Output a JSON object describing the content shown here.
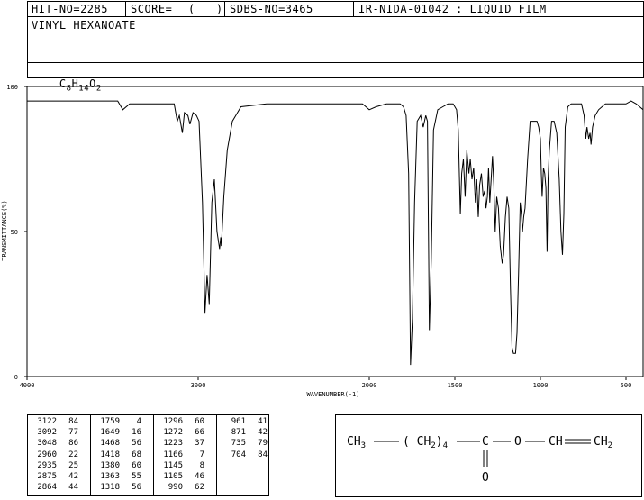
{
  "header": {
    "hit_no": "HIT-NO=2285",
    "score_label": "SCORE=",
    "score_value": "(   )",
    "sdbs_no": "SDBS-NO=3465",
    "ir_info": "IR-NIDA-01042 : LIQUID FILM"
  },
  "compound": {
    "name": "VINYL HEXANOATE",
    "formula_parts": [
      {
        "text": "C",
        "sub": false
      },
      {
        "text": "8",
        "sub": true
      },
      {
        "text": "H",
        "sub": false
      },
      {
        "text": "14",
        "sub": true
      },
      {
        "text": "O",
        "sub": false
      },
      {
        "text": "2",
        "sub": true
      }
    ]
  },
  "structure": {
    "ch3": "CH3",
    "ch2_group": "(CH2)4",
    "c": "C",
    "o_link": "O",
    "ch": "CH",
    "ch2_end": "CH2",
    "carbonyl_o": "O"
  },
  "peak_table": [
    [
      [
        "3122",
        "84"
      ],
      [
        "3092",
        "77"
      ],
      [
        "3048",
        "86"
      ],
      [
        "2960",
        "22"
      ],
      [
        "2935",
        "25"
      ],
      [
        "2875",
        "42"
      ],
      [
        "2864",
        "44"
      ]
    ],
    [
      [
        "1759",
        "4"
      ],
      [
        "1649",
        "16"
      ],
      [
        "1468",
        "56"
      ],
      [
        "1418",
        "68"
      ],
      [
        "1380",
        "60"
      ],
      [
        "1363",
        "55"
      ],
      [
        "1318",
        "56"
      ]
    ],
    [
      [
        "1296",
        "60"
      ],
      [
        "1272",
        "66"
      ],
      [
        "1223",
        "37"
      ],
      [
        "1166",
        "7"
      ],
      [
        "1145",
        "8"
      ],
      [
        "1105",
        "46"
      ],
      [
        "990",
        "62"
      ]
    ],
    [
      [
        "961",
        "41"
      ],
      [
        "871",
        "42"
      ],
      [
        "735",
        "79"
      ],
      [
        "704",
        "84"
      ]
    ]
  ],
  "chart_data": {
    "type": "line",
    "xlabel": "WAVENUMBER(-1)",
    "ylabel": "TRANSMITTANCE(%)",
    "xlim": [
      4000,
      400
    ],
    "ylim": [
      0,
      100
    ],
    "x_ticks": [
      4000,
      3000,
      2000,
      1500,
      1000,
      500
    ],
    "y_ticks": [
      0,
      50,
      100
    ],
    "series": [
      {
        "x": [
          4000,
          3800,
          3600,
          3470,
          3440,
          3400,
          3300,
          3200,
          3140,
          3122,
          3110,
          3092,
          3080,
          3060,
          3048,
          3030,
          3010,
          2995,
          2975,
          2960,
          2948,
          2935,
          2920,
          2905,
          2890,
          2875,
          2868,
          2864,
          2850,
          2830,
          2800,
          2750,
          2600,
          2400,
          2200,
          2100,
          2040,
          2000,
          1960,
          1900,
          1850,
          1820,
          1800,
          1785,
          1770,
          1759,
          1748,
          1735,
          1720,
          1700,
          1685,
          1670,
          1660,
          1649,
          1638,
          1625,
          1600,
          1570,
          1540,
          1510,
          1490,
          1480,
          1468,
          1460,
          1450,
          1440,
          1430,
          1418,
          1410,
          1400,
          1390,
          1380,
          1372,
          1363,
          1355,
          1345,
          1335,
          1326,
          1318,
          1310,
          1303,
          1296,
          1288,
          1280,
          1272,
          1264,
          1255,
          1245,
          1235,
          1223,
          1215,
          1205,
          1195,
          1185,
          1175,
          1166,
          1158,
          1152,
          1145,
          1137,
          1128,
          1118,
          1110,
          1105,
          1098,
          1090,
          1075,
          1060,
          1040,
          1020,
          1010,
          1000,
          995,
          990,
          982,
          975,
          968,
          961,
          955,
          948,
          935,
          920,
          905,
          890,
          880,
          871,
          863,
          855,
          840,
          820,
          800,
          780,
          760,
          745,
          735,
          728,
          718,
          710,
          704,
          695,
          680,
          660,
          640,
          620,
          600,
          580,
          560,
          540,
          520,
          500,
          470,
          440,
          420,
          400
        ],
        "y": [
          95,
          95,
          95,
          95,
          92,
          94,
          94,
          94,
          94,
          88,
          90,
          84,
          91,
          90,
          87,
          91,
          90,
          88,
          60,
          22,
          35,
          25,
          60,
          68,
          50,
          44,
          48,
          45,
          62,
          78,
          88,
          93,
          94,
          94,
          94,
          94,
          94,
          92,
          93,
          94,
          94,
          94,
          93,
          90,
          70,
          4,
          20,
          60,
          88,
          90,
          86,
          90,
          88,
          16,
          40,
          85,
          92,
          93,
          94,
          94,
          92,
          85,
          56,
          70,
          75,
          62,
          78,
          70,
          75,
          68,
          72,
          60,
          68,
          55,
          66,
          70,
          62,
          64,
          58,
          62,
          72,
          60,
          68,
          76,
          66,
          50,
          62,
          58,
          45,
          39,
          42,
          55,
          62,
          58,
          30,
          10,
          8,
          8,
          8,
          15,
          35,
          60,
          55,
          50,
          55,
          58,
          75,
          88,
          88,
          88,
          86,
          82,
          70,
          62,
          72,
          70,
          65,
          43,
          68,
          78,
          88,
          88,
          84,
          68,
          50,
          42,
          56,
          86,
          93,
          94,
          94,
          94,
          94,
          90,
          82,
          86,
          82,
          84,
          80,
          86,
          90,
          92,
          93,
          94,
          94,
          94,
          94,
          94,
          94,
          94,
          95,
          94,
          93,
          92
        ]
      }
    ]
  }
}
